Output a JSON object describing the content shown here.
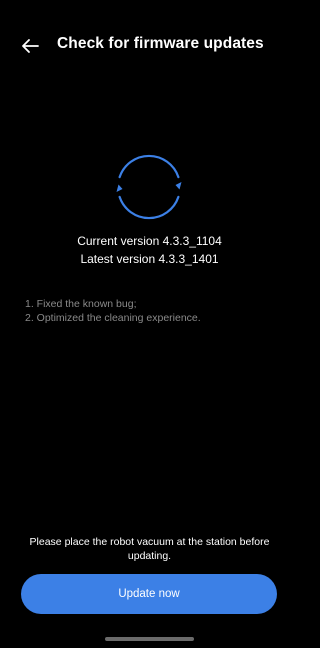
{
  "header": {
    "back_icon": "arrow-left-icon",
    "title": "Check for firmware updates"
  },
  "status_icon": "sync-icon",
  "accent_color": "#3c80e6",
  "versions": {
    "current": "Current version 4.3.3_1104",
    "latest": "Latest version 4.3.3_1401"
  },
  "release_notes": [
    "1. Fixed the known bug;",
    "2. Optimized the cleaning experience."
  ],
  "hint": "Please place the robot vacuum at the station before updating.",
  "update_button": {
    "label": "Update now"
  }
}
